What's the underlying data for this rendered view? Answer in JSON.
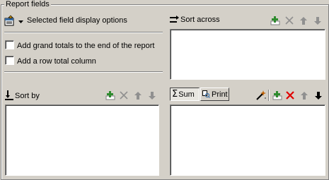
{
  "group_title": "Report fields",
  "display_options": {
    "label": "Selected field display options",
    "icon": "display-options-icon"
  },
  "checkboxes": [
    {
      "label": "Add grand totals to the end of the report",
      "checked": false
    },
    {
      "label": "Add a row total column",
      "checked": false
    }
  ],
  "sort_across": {
    "label": "Sort across",
    "icon": "sort-across-icon"
  },
  "sort_by": {
    "label": "Sort by",
    "icon": "sort-by-icon"
  },
  "tabs": {
    "sum_label": "Sum",
    "print_label": "Print",
    "active": "Sum"
  },
  "toolbar_icons": [
    "add-field-icon",
    "delete-icon",
    "move-up-icon",
    "move-down-icon"
  ],
  "colors": {
    "face": "#d4d0c8",
    "shadow": "#808080",
    "highlight": "#ffffff",
    "delete_active": "#e00000",
    "add_green": "#2e8b2e"
  }
}
